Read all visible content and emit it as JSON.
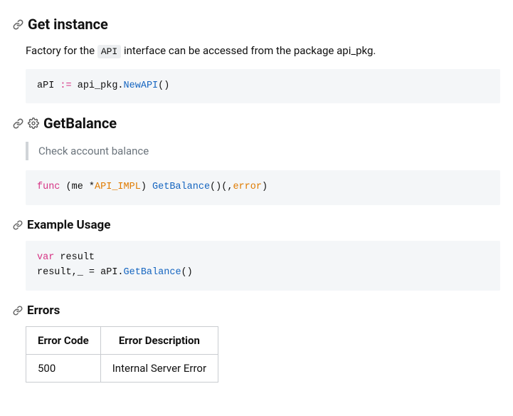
{
  "sections": {
    "get_instance": {
      "title": "Get instance",
      "desc_prefix": "Factory for the ",
      "desc_code": "API",
      "desc_suffix": " interface can be accessed from the package api_pkg.",
      "code": {
        "varName": "aPI",
        "op": ":=",
        "pkg": " api_pkg.",
        "fn": "NewAPI",
        "call": "()"
      }
    },
    "get_balance": {
      "title": "GetBalance",
      "note": "Check account balance",
      "code": {
        "kw": "func",
        "open": " (",
        "recv": "me *",
        "type": "API_IMPL",
        "close_recv": ") ",
        "fn": "GetBalance",
        "sig_mid": "()(,",
        "err": "error",
        "close": ")"
      }
    },
    "example": {
      "title": "Example Usage",
      "code": {
        "kw": "var",
        "line1_rest": " result",
        "line2_pre": "result,_ = aPI.",
        "fn": "GetBalance",
        "call": "()"
      }
    },
    "errors": {
      "title": "Errors",
      "headers": {
        "code": "Error Code",
        "desc": "Error Description"
      },
      "rows": [
        {
          "code": "500",
          "desc": "Internal Server Error"
        }
      ]
    }
  }
}
